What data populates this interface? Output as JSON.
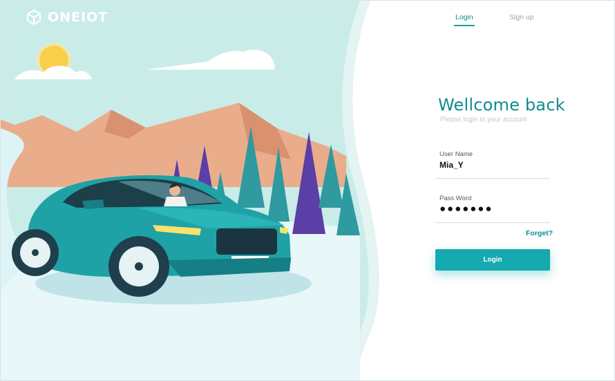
{
  "brand": {
    "name": "ONEIOT",
    "logo_icon": "cube-logo-icon"
  },
  "tabs": [
    {
      "label": "Login",
      "active": true
    },
    {
      "label": "Sign up",
      "active": false
    }
  ],
  "form": {
    "title": "Wellcome back",
    "subtitle": "Please login to your account",
    "username": {
      "label": "User Name",
      "value": "Mia_Y"
    },
    "password": {
      "label": "Pass Word",
      "value": "●●●●●●●"
    },
    "forgot_label": "Forget?",
    "login_button": "Login"
  },
  "colors": {
    "accent": "#14aab0",
    "accent_text": "#0d8e93",
    "sky": "#c9ece9",
    "mountain": "#e8a888",
    "tree_teal": "#2f9aa0",
    "tree_purple": "#5b3fa6",
    "car": "#1fa2a6"
  }
}
